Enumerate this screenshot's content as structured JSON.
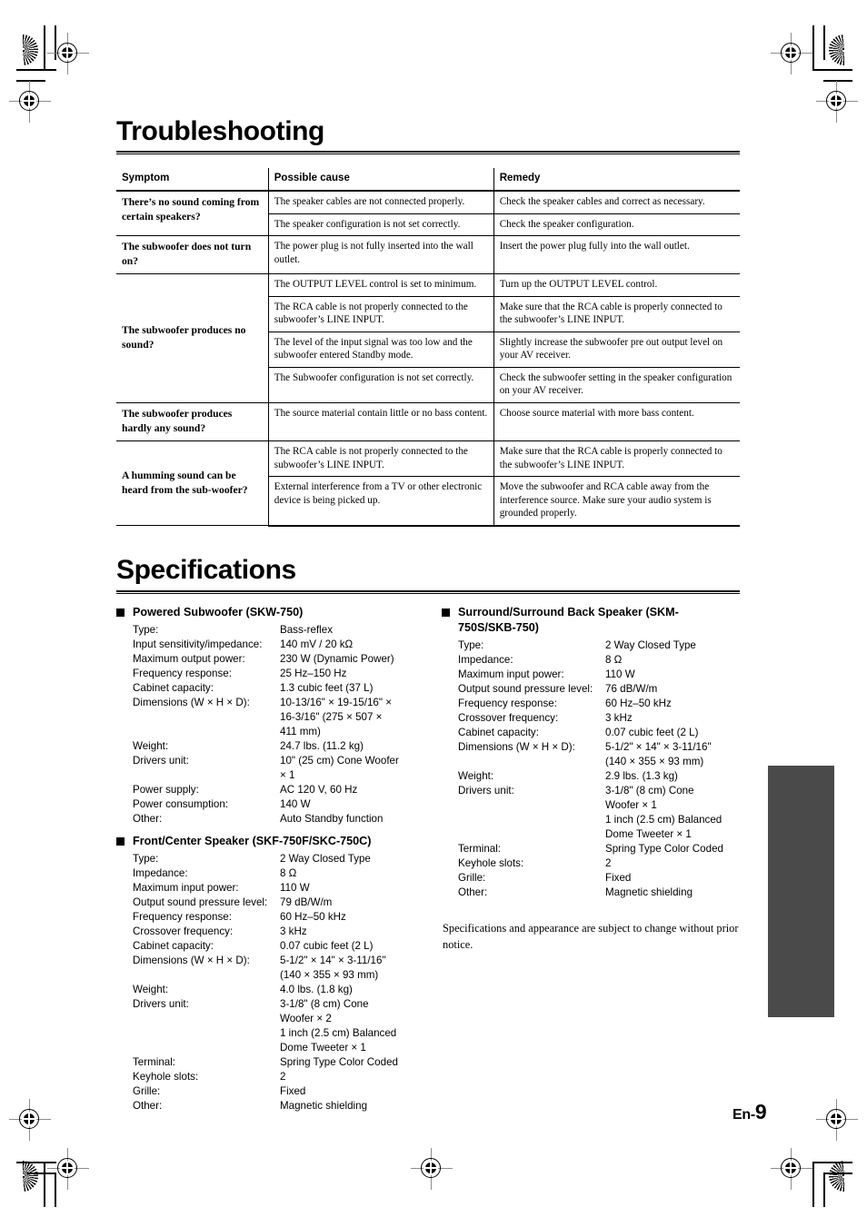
{
  "document": {
    "page_label": "En-",
    "page_number": "9"
  },
  "troubleshooting": {
    "title": "Troubleshooting",
    "columns": [
      "Symptom",
      "Possible cause",
      "Remedy"
    ],
    "groups": [
      {
        "symptom": "There’s no sound coming from certain speakers?",
        "rows": [
          {
            "cause": "The speaker cables are not connected properly.",
            "remedy": "Check the speaker cables and correct as necessary."
          },
          {
            "cause": "The speaker configuration is not set correctly.",
            "remedy": "Check the speaker configuration."
          }
        ]
      },
      {
        "symptom": "The subwoofer does not turn on?",
        "rows": [
          {
            "cause": "The power plug is not fully inserted into the wall outlet.",
            "remedy": "Insert the power plug fully into the wall outlet."
          }
        ]
      },
      {
        "symptom": "The subwoofer produces no sound?",
        "rows": [
          {
            "cause": "The OUTPUT LEVEL control is set to minimum.",
            "remedy": "Turn up the OUTPUT LEVEL control."
          },
          {
            "cause": "The RCA cable is not properly connected to the subwoofer’s LINE INPUT.",
            "remedy": "Make sure that the RCA cable is properly connected to the subwoofer’s LINE INPUT."
          },
          {
            "cause": "The level of the input signal was too low and the subwoofer entered Standby mode.",
            "remedy": "Slightly increase the subwoofer pre out output level on your AV receiver."
          },
          {
            "cause": "The Subwoofer configuration is not set correctly.",
            "remedy": "Check the subwoofer setting in the speaker configuration on your AV receiver."
          }
        ]
      },
      {
        "symptom": "The subwoofer produces hardly any sound?",
        "rows": [
          {
            "cause": "The source material contain little or no bass content.",
            "remedy": "Choose source material with more bass content."
          }
        ]
      },
      {
        "symptom": "A humming sound can be heard from the sub-woofer?",
        "rows": [
          {
            "cause": "The RCA cable is not properly connected to the subwoofer’s LINE INPUT.",
            "remedy": "Make sure that the RCA cable is properly connected to the subwoofer’s LINE INPUT."
          },
          {
            "cause": "External interference from a TV or other electronic device is being picked up.",
            "remedy": "Move the subwoofer and RCA cable away from the interference source. Make sure your audio system is grounded properly."
          }
        ]
      }
    ]
  },
  "specifications": {
    "title": "Specifications",
    "note": "Specifications and appearance are subject to change without prior notice.",
    "sections": [
      {
        "heading": "Powered Subwoofer (SKW-750)",
        "rows": [
          {
            "label": "Type:",
            "value": "Bass-reflex"
          },
          {
            "label": "Input sensitivity/impedance:",
            "value": "140 mV / 20 kΩ"
          },
          {
            "label": "Maximum output power:",
            "value": "230 W (Dynamic Power)"
          },
          {
            "label": "Frequency response:",
            "value": "25 Hz–150 Hz"
          },
          {
            "label": "Cabinet capacity:",
            "value": "1.3 cubic feet (37 L)"
          },
          {
            "label": "Dimensions (W × H × D):",
            "value": "10-13/16\" × 19-15/16\" ×\n16-3/16\" (275 × 507 ×\n411 mm)"
          },
          {
            "label": "Weight:",
            "value": "24.7 lbs. (11.2 kg)"
          },
          {
            "label": "Drivers unit:",
            "value": "10\" (25 cm) Cone Woofer\n× 1"
          },
          {
            "label": "Power supply:",
            "value": "AC 120 V, 60 Hz"
          },
          {
            "label": "Power consumption:",
            "value": "140 W"
          },
          {
            "label": "Other:",
            "value": "Auto Standby function"
          }
        ]
      },
      {
        "heading": "Front/Center Speaker (SKF-750F/SKC-750C)",
        "rows": [
          {
            "label": "Type:",
            "value": "2 Way Closed Type"
          },
          {
            "label": "Impedance:",
            "value": "8 Ω"
          },
          {
            "label": "Maximum input power:",
            "value": "110 W"
          },
          {
            "label": "Output sound pressure level:",
            "value": "79 dB/W/m"
          },
          {
            "label": "Frequency response:",
            "value": "60 Hz–50 kHz"
          },
          {
            "label": "Crossover frequency:",
            "value": "3 kHz"
          },
          {
            "label": "Cabinet capacity:",
            "value": "0.07 cubic feet (2 L)"
          },
          {
            "label": "Dimensions (W × H × D):",
            "value": "5-1/2\" × 14\" × 3-11/16\"\n(140 × 355 × 93 mm)"
          },
          {
            "label": "Weight:",
            "value": "4.0 lbs. (1.8 kg)"
          },
          {
            "label": "Drivers unit:",
            "value": "3-1/8\" (8 cm) Cone\nWoofer × 2\n1 inch (2.5 cm) Balanced\nDome Tweeter × 1"
          },
          {
            "label": "Terminal:",
            "value": "Spring Type Color Coded"
          },
          {
            "label": "Keyhole slots:",
            "value": "2"
          },
          {
            "label": "Grille:",
            "value": "Fixed"
          },
          {
            "label": "Other:",
            "value": "Magnetic shielding"
          }
        ]
      },
      {
        "heading": "Surround/Surround Back Speaker (SKM-750S/SKB-750)",
        "rows": [
          {
            "label": "Type:",
            "value": "2 Way Closed Type"
          },
          {
            "label": "Impedance:",
            "value": "8 Ω"
          },
          {
            "label": "Maximum input power:",
            "value": "110 W"
          },
          {
            "label": "Output sound pressure level:",
            "value": "76 dB/W/m"
          },
          {
            "label": "Frequency response:",
            "value": "60 Hz–50 kHz"
          },
          {
            "label": "Crossover frequency:",
            "value": "3 kHz"
          },
          {
            "label": "Cabinet capacity:",
            "value": "0.07 cubic feet (2 L)"
          },
          {
            "label": "Dimensions (W × H × D):",
            "value": "5-1/2\" × 14\" × 3-11/16\"\n(140 × 355 × 93 mm)"
          },
          {
            "label": "Weight:",
            "value": "2.9 lbs. (1.3 kg)"
          },
          {
            "label": "Drivers unit:",
            "value": "3-1/8\" (8 cm) Cone\nWoofer × 1\n1 inch (2.5 cm) Balanced\nDome Tweeter × 1"
          },
          {
            "label": "Terminal:",
            "value": "Spring Type Color Coded"
          },
          {
            "label": "Keyhole slots:",
            "value": "2"
          },
          {
            "label": "Grille:",
            "value": "Fixed"
          },
          {
            "label": "Other:",
            "value": "Magnetic shielding"
          }
        ]
      }
    ]
  },
  "print_marks": {
    "accent_color": "#4a4a4a"
  }
}
